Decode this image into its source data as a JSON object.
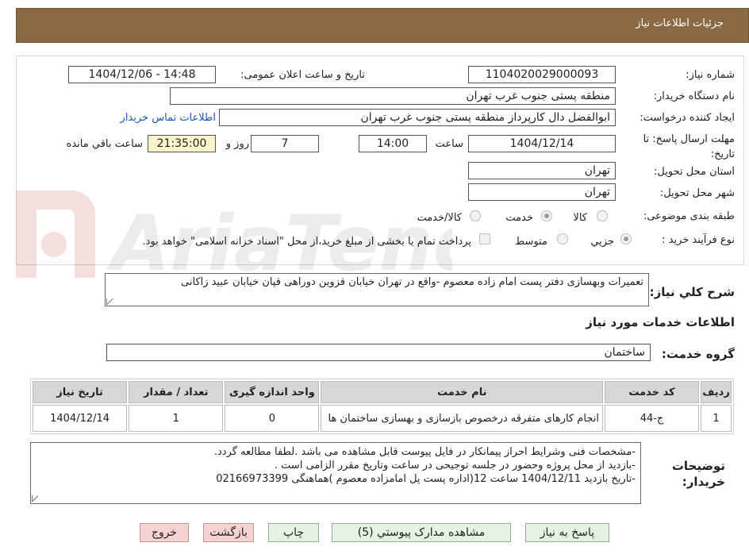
{
  "header": {
    "title": "جزئیات اطلاعات نیاز"
  },
  "watermark": {
    "text": "AriaTender.neT"
  },
  "form": {
    "need_number_label": "شماره نیاز:",
    "need_number": "1104020029000093",
    "announce_label": "تاریخ و ساعت اعلان عمومی:",
    "announce_value": "1404/12/06 - 14:48",
    "buyer_org_label": "نام دستگاه خریدار:",
    "buyer_org": "منطقه پستی جنوب غرب تهران",
    "requester_label": "ایجاد کننده درخواست:",
    "requester": "ابوالفضل  دال  کارپرداز منطقه پستی جنوب غرب تهران",
    "contact_link": "اطلاعات تماس خریدار",
    "deadline_label": "مهلت ارسال پاسخ: تا تاریخ:",
    "deadline_date": "1404/12/14",
    "time_label": "ساعت",
    "deadline_time": "14:00",
    "days_value": "7",
    "days_label": "روز و",
    "remaining_time": "21:35:00",
    "remaining_label": "ساعت باقي مانده",
    "province_label": "استان محل تحویل:",
    "province": "تهران",
    "city_label": "شهر محل تحویل:",
    "city": "تهران",
    "category_label": "طبقه بندی موضوعی:",
    "category_options": [
      "کالا",
      "خدمت",
      "کالا/خدمت"
    ],
    "category_selected": "خدمت",
    "process_label": "نوع فرآیند خرید :",
    "process_options": [
      "جزیي",
      "متوسط"
    ],
    "process_selected": "جزیي",
    "payment_note": "پرداخت تمام یا بخشی از مبلغ خرید،از محل \"اسناد خزانه اسلامی\" خواهد بود."
  },
  "summary": {
    "label": "شرح کلي نیاز:",
    "text": "تعمیرات وبهسازی دفتر پست امام زاده معصوم -واقع در تهران خیابان قزوین دوراهی قپان خیابان عبید زاکانی"
  },
  "services_section": {
    "title": "اطلاعات خدمات مورد نیاز",
    "group_label": "گروه خدمت:",
    "group_value": "ساختمان"
  },
  "table": {
    "headers": [
      "ردیف",
      "کد خدمت",
      "نام خدمت",
      "واحد اندازه گیری",
      "تعداد / مقدار",
      "تاریخ نیاز"
    ],
    "rows": [
      [
        "1",
        "ج-44",
        "انجام کارهای متفرقه درخصوص بازسازی و بهسازی ساختمان ها",
        "0",
        "1",
        "1404/12/14"
      ]
    ]
  },
  "notes": {
    "label_line1": "توضیحات",
    "label_line2": "خریدار:",
    "lines": [
      "-مشخصات فنی وشرایط احراز پیمانکار در فایل پیوست قابل مشاهده می باشد .لطفا مطالعه گردد.",
      "-بازدید از محل پروژه وحضور در جلسه توجیحی در ساعت وتاریخ مقرر الزامی است .",
      "-تاریخ بازدید 1404/12/11 ساعت 12(اداره پست پل امامزاده معصوم )هماهنگی 02166973399"
    ]
  },
  "buttons": {
    "reply": "پاسخ به نیاز",
    "view_docs": "مشاهده مدارک پیوستي (5)",
    "print": "چاپ",
    "back": "بازگشت",
    "exit": "خروج"
  },
  "colors": {
    "header_bg": "#8a6a44",
    "link": "#1a56b8",
    "button_green": "#e6f3e4",
    "button_pink": "#f6d2d2",
    "highlight_yellow": "#fbf3c9"
  }
}
